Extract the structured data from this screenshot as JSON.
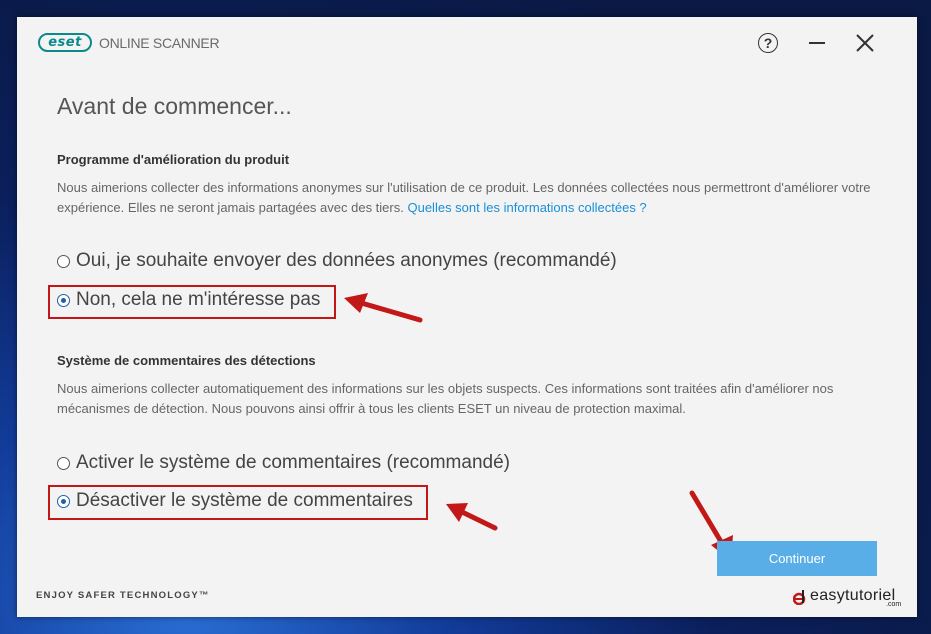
{
  "titlebar": {
    "logo": "eset",
    "product_name": "ONLINE SCANNER",
    "help_icon": "help-icon",
    "minimize_icon": "minimize-icon",
    "close_icon": "close-icon"
  },
  "page": {
    "title": "Avant de commencer..."
  },
  "section1": {
    "title": "Programme d'amélioration du produit",
    "description": "Nous aimerions collecter des informations anonymes sur l'utilisation de ce produit. Les données collectées nous permettront d'améliorer votre expérience. Elles ne seront jamais partagées avec des tiers.",
    "link": "Quelles sont les informations collectées ?",
    "options": [
      {
        "label": "Oui, je souhaite envoyer des données anonymes (recommandé)",
        "checked": false
      },
      {
        "label": "Non, cela ne m'intéresse pas",
        "checked": true
      }
    ]
  },
  "section2": {
    "title": "Système de commentaires des détections",
    "description": "Nous aimerions collecter automatiquement des informations sur les objets suspects. Ces informations sont traitées afin d'améliorer nos mécanismes de détection. Nous pouvons ainsi offrir à tous les clients ESET un niveau de protection maximal.",
    "options": [
      {
        "label": "Activer le système de commentaires (recommandé)",
        "checked": false
      },
      {
        "label": "Désactiver le système de commentaires",
        "checked": true
      }
    ]
  },
  "actions": {
    "continue_label": "Continuer"
  },
  "footer": {
    "tagline": "ENJOY SAFER TECHNOLOGY™"
  },
  "watermark": {
    "text": "easytutoriel",
    "sub": ".com"
  },
  "colors": {
    "accent": "#5aaee8",
    "brand": "#0a8a8a",
    "highlight": "#c21818",
    "link": "#1a8fd8"
  }
}
